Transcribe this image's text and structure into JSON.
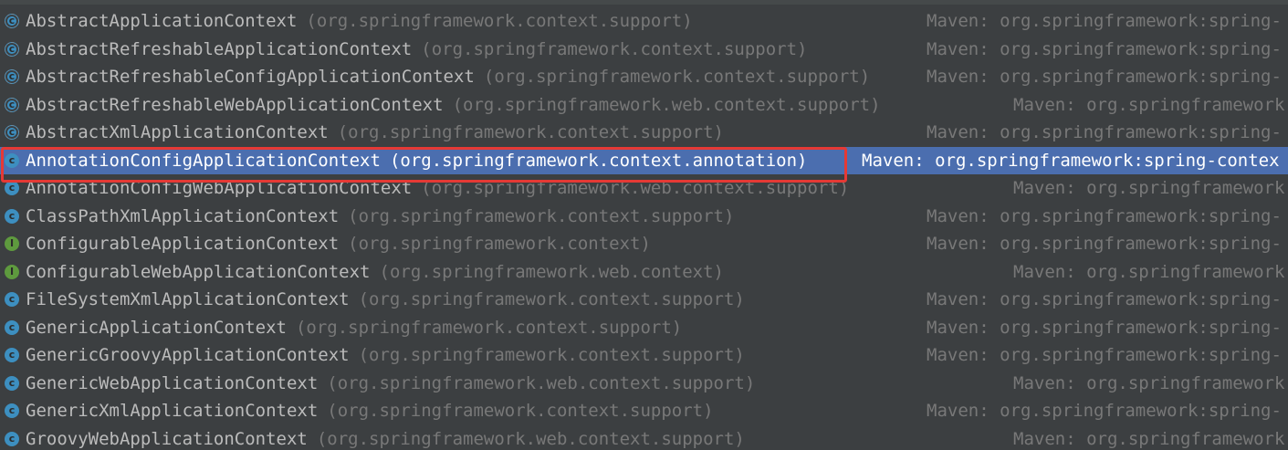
{
  "rows": [
    {
      "name": "AbstractApplicationContext",
      "pkg": "(org.springframework.context.support)",
      "lib": "Maven: org.springframework:spring-",
      "icon": "abstract-class-icon",
      "kind": "ac",
      "col": "a"
    },
    {
      "name": "AbstractRefreshableApplicationContext",
      "pkg": "(org.springframework.context.support)",
      "lib": "Maven: org.springframework:spring-",
      "icon": "abstract-class-icon",
      "kind": "ac",
      "col": "a"
    },
    {
      "name": "AbstractRefreshableConfigApplicationContext",
      "pkg": "(org.springframework.context.support)",
      "lib": "Maven: org.springframework:spring-",
      "icon": "abstract-class-icon",
      "kind": "ac",
      "col": "a"
    },
    {
      "name": "AbstractRefreshableWebApplicationContext",
      "pkg": "(org.springframework.web.context.support)",
      "lib": "Maven: org.springframework",
      "icon": "abstract-class-icon",
      "kind": "ac",
      "col": "b"
    },
    {
      "name": "AbstractXmlApplicationContext",
      "pkg": "(org.springframework.context.support)",
      "lib": "Maven: org.springframework:spring-",
      "icon": "abstract-class-icon",
      "kind": "ac",
      "col": "a"
    },
    {
      "name": "AnnotationConfigApplicationContext",
      "pkg": "(org.springframework.context.annotation)",
      "lib": "Maven: org.springframework:spring-contex",
      "icon": "class-icon",
      "kind": "c",
      "col": "sel",
      "selected": true
    },
    {
      "name": "AnnotationConfigWebApplicationContext",
      "pkg": "(org.springframework.web.context.support)",
      "lib": "Maven: org.springframework",
      "icon": "class-icon",
      "kind": "c",
      "col": "b"
    },
    {
      "name": "ClassPathXmlApplicationContext",
      "pkg": "(org.springframework.context.support)",
      "lib": "Maven: org.springframework:spring-",
      "icon": "class-icon",
      "kind": "c",
      "col": "a"
    },
    {
      "name": "ConfigurableApplicationContext",
      "pkg": "(org.springframework.context)",
      "lib": "Maven: org.springframework:spring-",
      "icon": "interface-icon",
      "kind": "i",
      "col": "a"
    },
    {
      "name": "ConfigurableWebApplicationContext",
      "pkg": "(org.springframework.web.context)",
      "lib": "Maven: org.springframework",
      "icon": "interface-icon",
      "kind": "i",
      "col": "b"
    },
    {
      "name": "FileSystemXmlApplicationContext",
      "pkg": "(org.springframework.context.support)",
      "lib": "Maven: org.springframework:spring-",
      "icon": "class-icon",
      "kind": "c",
      "col": "a"
    },
    {
      "name": "GenericApplicationContext",
      "pkg": "(org.springframework.context.support)",
      "lib": "Maven: org.springframework:spring-",
      "icon": "class-icon",
      "kind": "c",
      "col": "a"
    },
    {
      "name": "GenericGroovyApplicationContext",
      "pkg": "(org.springframework.context.support)",
      "lib": "Maven: org.springframework:spring-",
      "icon": "class-icon",
      "kind": "c",
      "col": "a"
    },
    {
      "name": "GenericWebApplicationContext",
      "pkg": "(org.springframework.web.context.support)",
      "lib": "Maven: org.springframework",
      "icon": "class-icon",
      "kind": "c",
      "col": "b"
    },
    {
      "name": "GenericXmlApplicationContext",
      "pkg": "(org.springframework.context.support)",
      "lib": "Maven: org.springframework:spring-",
      "icon": "class-icon",
      "kind": "c",
      "col": "a"
    },
    {
      "name": "GroovyWebApplicationContext",
      "pkg": "(org.springframework.web.context.support)",
      "lib": "Maven: org.springframework",
      "icon": "class-icon",
      "kind": "c",
      "col": "b"
    }
  ],
  "icon_letters": {
    "c": "c",
    "i": "I",
    "ac": "c"
  },
  "colors": {
    "background": "#3c3f41",
    "selection": "#4b6eaf",
    "highlight_border": "#e53935",
    "class_icon": "#3d8fc0",
    "interface_icon": "#5e9a3e"
  }
}
